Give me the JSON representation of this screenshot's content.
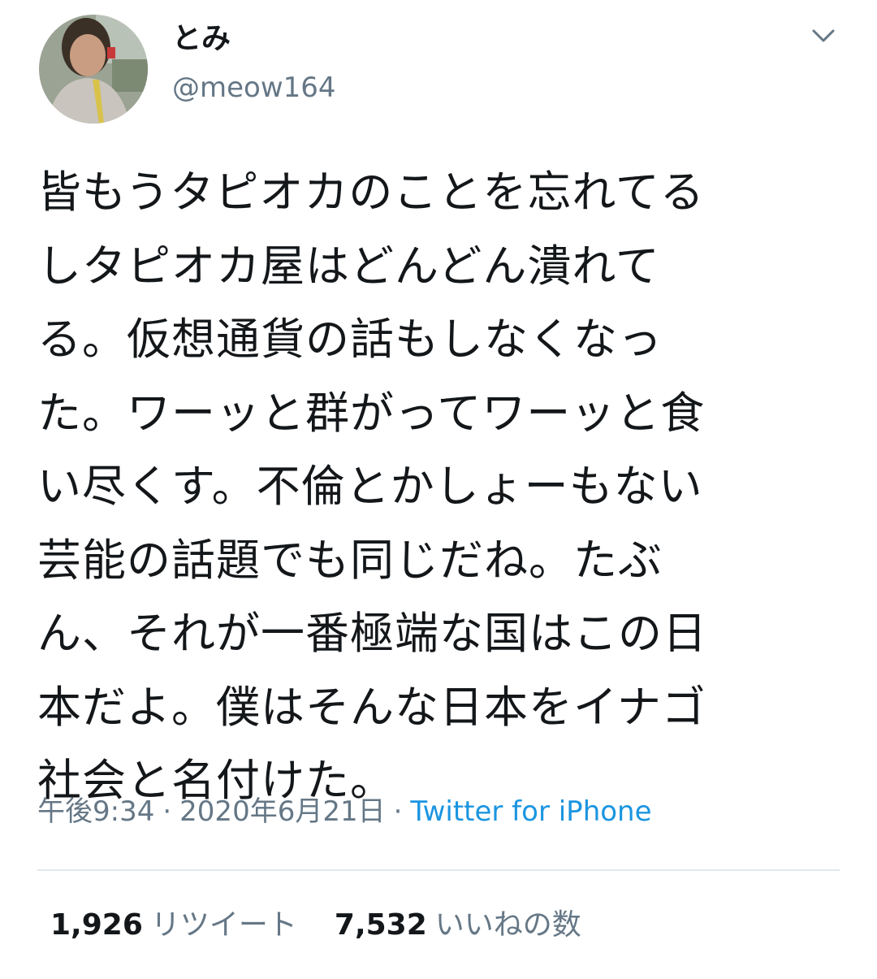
{
  "author": {
    "display_name": "とみ",
    "handle": "@meow164",
    "avatar_icon": "profile-photo"
  },
  "menu": {
    "icon": "chevron-down-icon"
  },
  "tweet": {
    "lines": [
      "皆もうタピオカのことを忘れてる",
      "しタピオカ屋はどんどん潰れて",
      "る。仮想通貨の話もしなくなっ",
      "た。ワーッと群がってワーッと食",
      "い尽くす。不倫とかしょーもない",
      "芸能の話題でも同じだね。たぶ",
      "ん、それが一番極端な国はこの日",
      "本だよ。僕はそんな日本をイナゴ",
      "社会と名付けた。"
    ]
  },
  "meta": {
    "time": "午後9:34",
    "separator": "·",
    "date": "2020年6月21日",
    "source": "Twitter for iPhone"
  },
  "stats": {
    "retweets_count": "1,926",
    "retweets_label": "リツイート",
    "likes_count": "7,532",
    "likes_label": "いいねの数"
  },
  "colors": {
    "text": "#14171a",
    "secondary": "#657786",
    "link": "#1b95e0",
    "divider": "#e1e8ed"
  }
}
